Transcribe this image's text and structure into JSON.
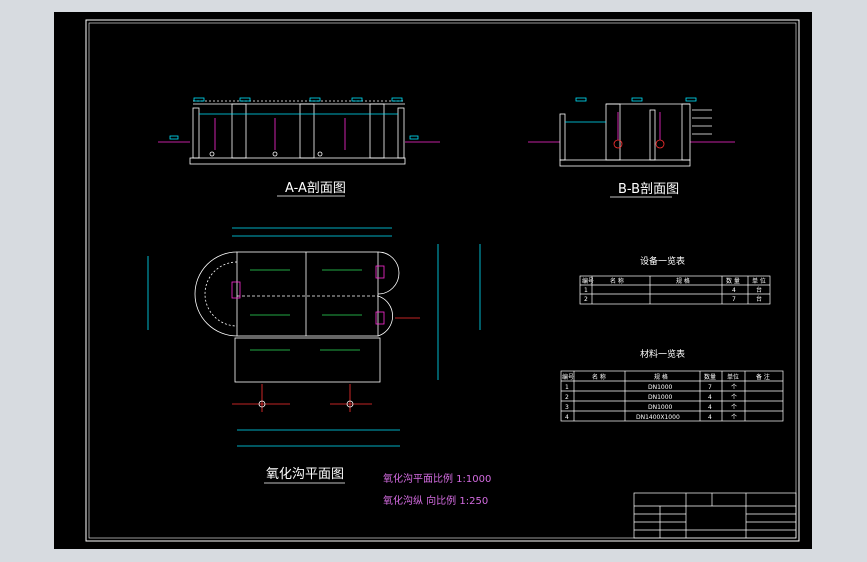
{
  "titles": {
    "section_a": "A-A剖面图",
    "section_b": "B-B剖面图",
    "plan": "氧化沟平面图"
  },
  "scale_notes": {
    "plan_scale": "氧化沟平面比例 1:1000",
    "section_scale": "氧化沟纵 向比例 1:250"
  },
  "equipment_table": {
    "title": "设备一览表",
    "headers": [
      "编号",
      "名 称",
      "规 格",
      "数 量",
      "单 位"
    ],
    "rows": [
      [
        "1",
        "",
        "",
        "4",
        "台"
      ],
      [
        "2",
        "",
        "",
        "7",
        "台"
      ]
    ]
  },
  "materials_table": {
    "title": "材料一览表",
    "headers": [
      "编号",
      "名 称",
      "规 格",
      "数量",
      "单位",
      "备 注"
    ],
    "rows": [
      [
        "1",
        "",
        "DN1000",
        "7",
        "个",
        ""
      ],
      [
        "2",
        "",
        "DN1000",
        "4",
        "个",
        ""
      ],
      [
        "3",
        "",
        "DN1000",
        "4",
        "个",
        ""
      ],
      [
        "4",
        "",
        "DN1400X1000",
        "4",
        "个",
        ""
      ]
    ]
  },
  "colors": {
    "frame": "#ffffff",
    "line_white": "#ffffff",
    "line_cyan": "#00e5ff",
    "line_magenta": "#ff2bd6",
    "line_green": "#2ee05a",
    "line_yellow": "#ffe14d",
    "line_red": "#ff3030",
    "text_magenta": "#d36be0"
  }
}
